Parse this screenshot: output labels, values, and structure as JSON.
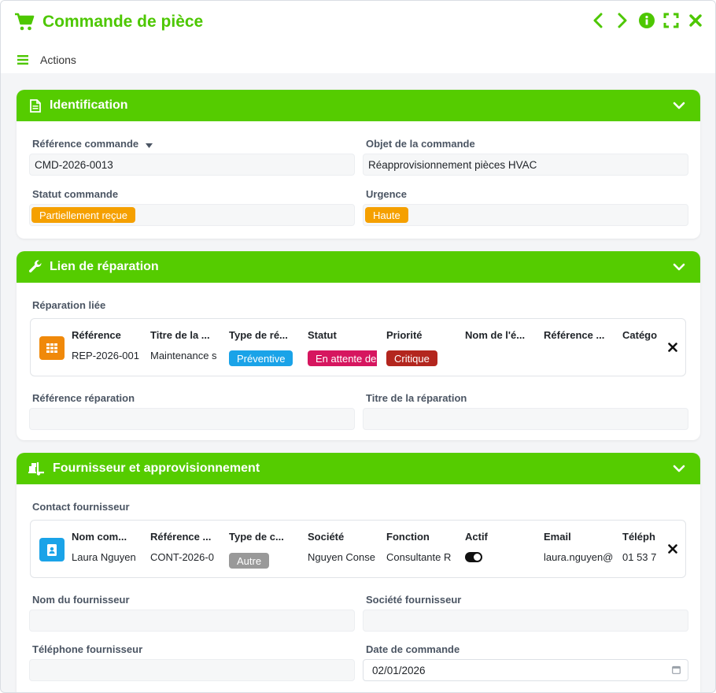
{
  "window": {
    "title": "Commande de pièce",
    "actions_label": "Actions"
  },
  "colors": {
    "accent": "#55cc00",
    "orange_badge": "#f5a000",
    "blue_badge": "#1aa3e8",
    "pink_badge": "#d6165f",
    "red_badge": "#b3261e",
    "grey_badge": "#999999"
  },
  "icons": {
    "title": "cart-icon",
    "nav_prev": "chevron-left-icon",
    "nav_next": "chevron-right-icon",
    "info": "info-icon",
    "expand": "expand-icon",
    "close": "close-icon",
    "menu": "hamburger-icon"
  },
  "identification": {
    "title": "Identification",
    "ref_label": "Référence commande",
    "ref_value": "CMD-2026-0013",
    "object_label": "Objet de la commande",
    "object_value": "Réapprovisionnement pièces HVAC",
    "status_label": "Statut commande",
    "status_value": "Partiellement reçue",
    "urgency_label": "Urgence",
    "urgency_value": "Haute"
  },
  "repair": {
    "title": "Lien de réparation",
    "linked_label": "Réparation liée",
    "columns": [
      "Référence",
      "Titre de la ...",
      "Type de ré...",
      "Statut",
      "Priorité",
      "Nom de l'é...",
      "Référence ...",
      "Catégo"
    ],
    "row": {
      "reference": "REP-2026-001",
      "title": "Maintenance s",
      "type": "Préventive",
      "status": "En attente de",
      "priority": "Critique"
    },
    "ref_label": "Référence réparation",
    "title_label": "Titre de la réparation"
  },
  "supplier": {
    "title": "Fournisseur et approvisionnement",
    "contact_label": "Contact fournisseur",
    "columns": [
      "Nom com...",
      "Référence ...",
      "Type de c...",
      "Société",
      "Fonction",
      "Actif",
      "Email",
      "Téléph"
    ],
    "row": {
      "name": "Laura Nguyen",
      "reference": "CONT-2026-0",
      "type": "Autre",
      "company": "Nguyen Conse",
      "function": "Consultante R",
      "email": "laura.nguyen@",
      "phone": "01 53 7"
    },
    "name_label": "Nom du fournisseur",
    "company_label": "Société fournisseur",
    "phone_label": "Téléphone fournisseur",
    "date_label": "Date de commande",
    "date_value": "02/01/2026"
  }
}
